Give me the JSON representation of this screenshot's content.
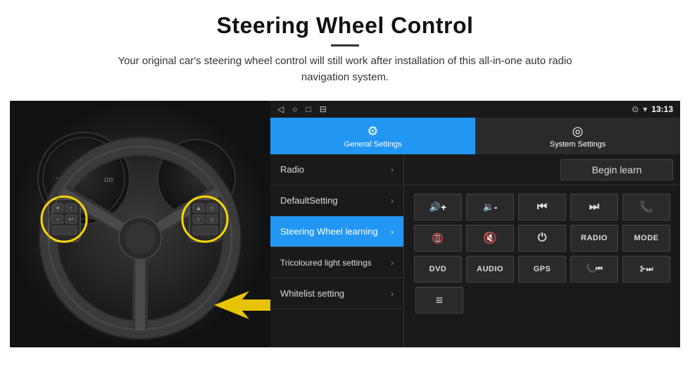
{
  "header": {
    "title": "Steering Wheel Control",
    "divider": true,
    "subtitle": "Your original car's steering wheel control will still work after installation of this all-in-one auto radio navigation system."
  },
  "status_bar": {
    "icons": [
      "◁",
      "○",
      "□",
      "⊟"
    ],
    "right_icons": [
      "⊙",
      "▾",
      "time"
    ],
    "time": "13:13"
  },
  "tabs": [
    {
      "id": "general",
      "label": "General Settings",
      "icon": "⚙",
      "active": true
    },
    {
      "id": "system",
      "label": "System Settings",
      "icon": "◎",
      "active": false
    }
  ],
  "menu_items": [
    {
      "id": "radio",
      "label": "Radio",
      "active": false
    },
    {
      "id": "default",
      "label": "DefaultSetting",
      "active": false
    },
    {
      "id": "steering",
      "label": "Steering Wheel learning",
      "active": true
    },
    {
      "id": "tricoloured",
      "label": "Tricoloured light settings",
      "active": false
    },
    {
      "id": "whitelist",
      "label": "Whitelist setting",
      "active": false
    }
  ],
  "begin_learn_btn": "Begin learn",
  "control_buttons": {
    "row1": [
      {
        "id": "vol-up",
        "content": "🔊+",
        "type": "icon"
      },
      {
        "id": "vol-down",
        "content": "🔉-",
        "type": "icon"
      },
      {
        "id": "prev-track",
        "content": "|◀◀",
        "type": "icon"
      },
      {
        "id": "next-track",
        "content": "▶▶|",
        "type": "icon"
      },
      {
        "id": "phone",
        "content": "📞",
        "type": "icon"
      }
    ],
    "row2": [
      {
        "id": "hang-up",
        "content": "📞↩",
        "type": "icon"
      },
      {
        "id": "mute",
        "content": "🔇✗",
        "type": "icon"
      },
      {
        "id": "power",
        "content": "⏻",
        "type": "icon"
      },
      {
        "id": "radio-btn",
        "content": "RADIO",
        "type": "text"
      },
      {
        "id": "mode-btn",
        "content": "MODE",
        "type": "text"
      }
    ],
    "row3": [
      {
        "id": "dvd-btn",
        "content": "DVD",
        "type": "text"
      },
      {
        "id": "audio-btn",
        "content": "AUDIO",
        "type": "text"
      },
      {
        "id": "gps-btn",
        "content": "GPS",
        "type": "text"
      },
      {
        "id": "tel-prev",
        "content": "📞|◀",
        "type": "icon"
      },
      {
        "id": "tel-next",
        "content": "⊱▶|",
        "type": "icon"
      }
    ],
    "row4": [
      {
        "id": "menu-icon",
        "content": "≡",
        "type": "icon"
      }
    ]
  }
}
